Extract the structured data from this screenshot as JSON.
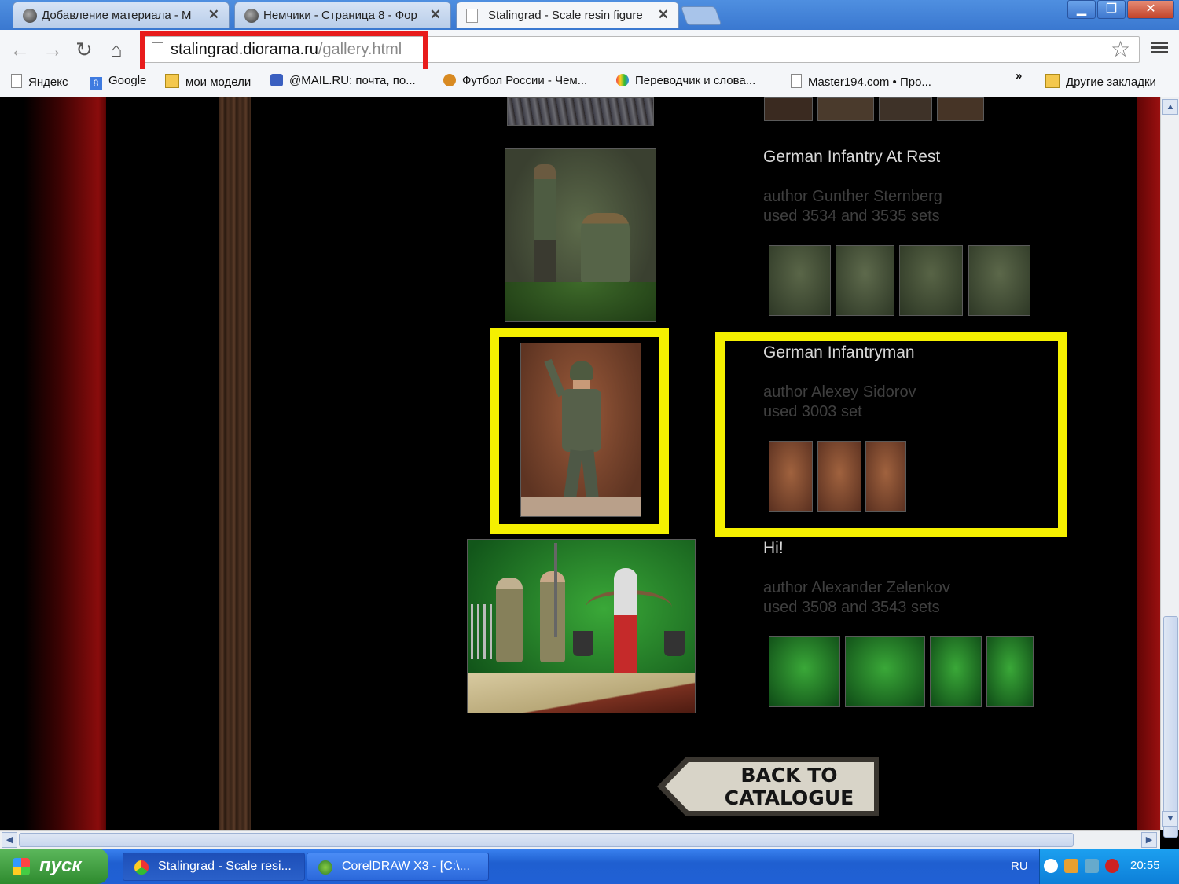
{
  "browser": {
    "tabs": [
      {
        "title": "Добавление материала - M",
        "active": false
      },
      {
        "title": "Немчики - Страница 8 - Фор",
        "active": false
      },
      {
        "title": "Stalingrad - Scale resin figure",
        "active": true
      }
    ],
    "url_host": "stalingrad.diorama.ru",
    "url_path": "/gallery.html",
    "bookmarks": [
      {
        "label": "Яндекс",
        "icon": "page-icon"
      },
      {
        "label": "Google",
        "icon": "google-icon"
      },
      {
        "label": "мои модели",
        "icon": "folder-icon"
      },
      {
        "label": "@MAIL.RU: почта, по...",
        "icon": "mail-icon"
      },
      {
        "label": "Футбол России - Чем...",
        "icon": "ball-icon"
      },
      {
        "label": "Переводчик и слова...",
        "icon": "translate-icon"
      },
      {
        "label": "Master194.com • Про...",
        "icon": "page-icon"
      }
    ],
    "overflow": "»",
    "other_bookmarks": "Другие закладки"
  },
  "gallery": {
    "items": [
      {
        "title": "German Infantry At Rest",
        "author": "author Gunther Sternberg",
        "sets": "used 3534 and 3535 sets"
      },
      {
        "title": "German Infantryman",
        "author": "author Alexey Sidorov",
        "sets": "used 3003 set"
      },
      {
        "title": "Hi!",
        "author": "author Alexander Zelenkov",
        "sets": "used 3508 and 3543 sets"
      }
    ],
    "back_line1": "BACK TO",
    "back_line2": "CATALOGUE"
  },
  "taskbar": {
    "start": "пуск",
    "tasks": [
      {
        "label": "Stalingrad - Scale resi...",
        "active": true
      },
      {
        "label": "CorelDRAW X3 - [C:\\...",
        "active": false
      }
    ],
    "lang": "RU",
    "clock": "20:55"
  },
  "colors": {
    "highlight_red": "#e81c1c",
    "highlight_yellow": "#f5f000",
    "page_bg": "#000000"
  }
}
